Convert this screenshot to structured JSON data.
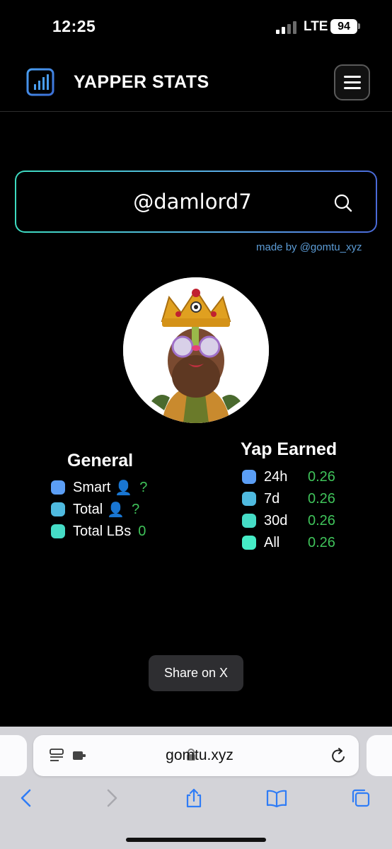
{
  "status_bar": {
    "time": "12:25",
    "network": "LTE",
    "battery": "94"
  },
  "header": {
    "title": "YAPPER STATS",
    "logo_icon": "bar-chart-icon",
    "menu_icon": "hamburger-menu-icon"
  },
  "search": {
    "value": "@damlord7",
    "placeholder": "",
    "icon": "search-icon",
    "credit": "made by @gomtu_xyz"
  },
  "colors": {
    "accent_green": "#3fc35a",
    "dot_blue": "#5b9ef5",
    "dot_cyan": "#4fbadf",
    "dot_teal": "#45dcc6",
    "credit_blue": "#5c9cd6"
  },
  "general": {
    "title": "General",
    "rows": [
      {
        "label": "Smart",
        "icon": "person-icon",
        "value": "?"
      },
      {
        "label": "Total",
        "icon": "person-icon",
        "value": "?"
      },
      {
        "label": "Total LBs",
        "value": "0"
      }
    ]
  },
  "yap_earned": {
    "title": "Yap Earned",
    "rows": [
      {
        "label": "24h",
        "value": "0.26"
      },
      {
        "label": "7d",
        "value": "0.26"
      },
      {
        "label": "30d",
        "value": "0.26"
      },
      {
        "label": "All",
        "value": "0.26"
      }
    ]
  },
  "share": {
    "label": "Share on X"
  },
  "browser": {
    "url": "gomtu.xyz"
  }
}
